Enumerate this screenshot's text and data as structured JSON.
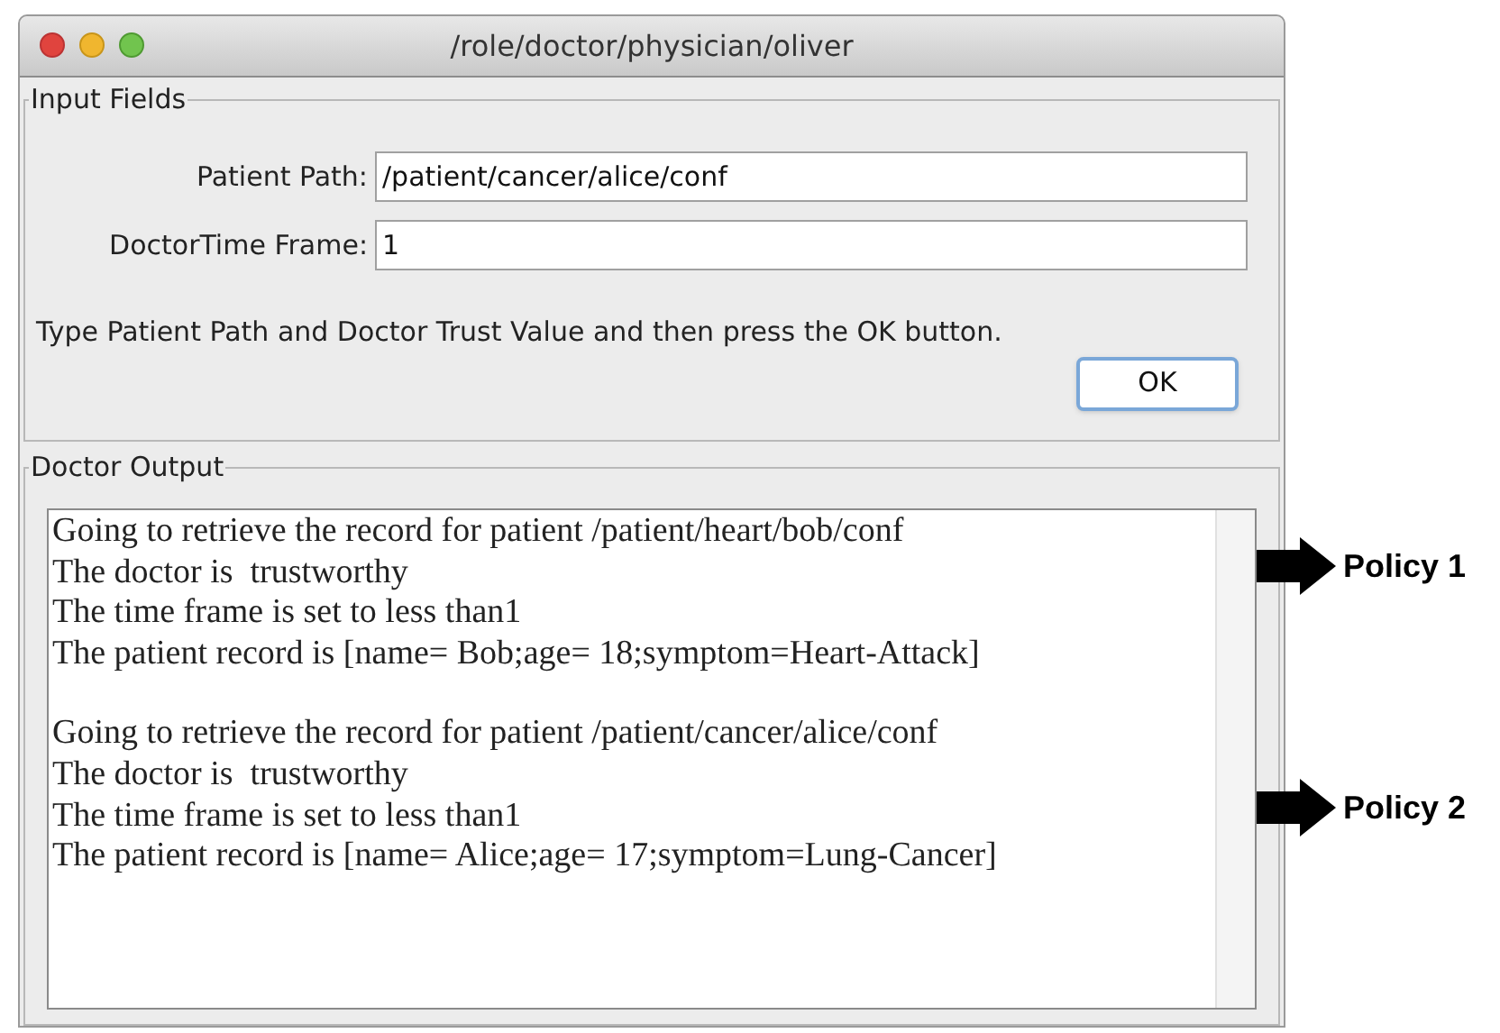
{
  "window": {
    "title": "/role/doctor/physician/oliver"
  },
  "input_fields": {
    "title": "Input Fields",
    "fields": [
      {
        "label": "Patient Path:",
        "value": "/patient/cancer/alice/conf"
      },
      {
        "label": "DoctorTime Frame:",
        "value": "1"
      }
    ],
    "instruction": "Type Patient Path and Doctor Trust Value and then press the OK button.",
    "ok_button": "OK"
  },
  "doctor_output": {
    "title": "Doctor Output",
    "blocks": [
      {
        "lines": [
          "Going to retrieve the record for patient /patient/heart/bob/conf",
          "The doctor is  trustworthy",
          "The time frame is set to less than1",
          "The patient record is [name= Bob;age= 18;symptom=Heart-Attack]"
        ]
      },
      {
        "lines": [
          "Going to retrieve the record for patient /patient/cancer/alice/conf",
          "The doctor is  trustworthy",
          "The time frame is set to less than1",
          "The patient record is [name= Alice;age= 17;symptom=Lung-Cancer]"
        ]
      }
    ]
  },
  "annotations": [
    {
      "label": "Policy 1"
    },
    {
      "label": "Policy 2"
    }
  ]
}
